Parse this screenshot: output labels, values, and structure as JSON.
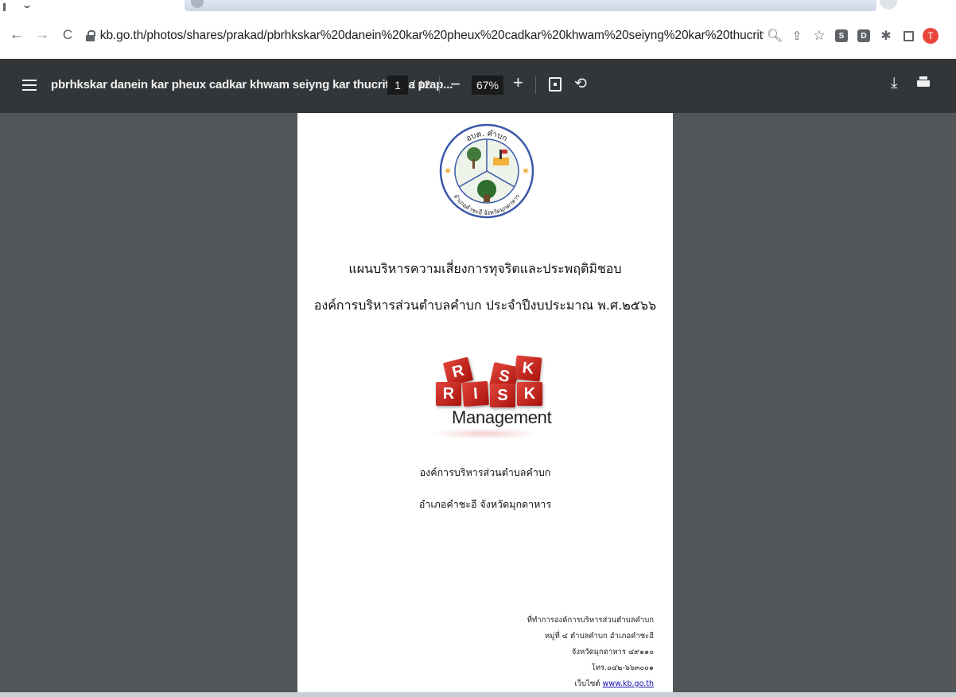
{
  "browser": {
    "url": "kb.go.th/photos/shares/prakad/pbrhkskar%20danein%20kar%20pheux%20cadkar%20khwam%20seiyng%20kar%20thucrit%20laea%20praphvti%20...",
    "extensions": [
      "S",
      "D"
    ],
    "profile_initial": "T"
  },
  "pdf_toolbar": {
    "title": "pbrhkskar danein kar pheux cadkar khwam seiyng kar thucrit laea prap...",
    "page_current": "1",
    "page_total": "/ 12",
    "zoom": "67%"
  },
  "document": {
    "seal_top_text": "อบต. คำบก",
    "seal_bottom_text": "อำเภอคำชะอี จังหวัดมุกดาหาร",
    "title_line1": "แผนบริหารความเสี่ยงการทุจริตและประพฤติมิชอบ",
    "title_line2": "องค์การบริหารส่วนตำบลคำบก  ประจำปีงบประมาณ พ.ศ.๒๕๖๖",
    "risk_letters_top": [
      "R",
      "S",
      "K"
    ],
    "risk_letters_bottom": [
      "R",
      "I",
      "S",
      "K"
    ],
    "risk_word": "Management",
    "org_name": "องค์การบริหารส่วนตำบลคำบก",
    "org_location": "อำเภอคำชะอี  จังหวัดมุกดาหาร",
    "address": {
      "line1": "ที่ทำการองค์การบริหารส่วนตำบลคำบก",
      "line2": "หมู่ที่ ๔  ตำบลคำบก อำเภอคำชะอี",
      "line3": "จังหวัดมุกดาหาร  ๔๙๑๑๐",
      "line4": "โทร.๐๔๒-๖๖๓๐๐๑",
      "website_label": "เว็บไซต์",
      "website": "www.kb.go.th"
    }
  }
}
